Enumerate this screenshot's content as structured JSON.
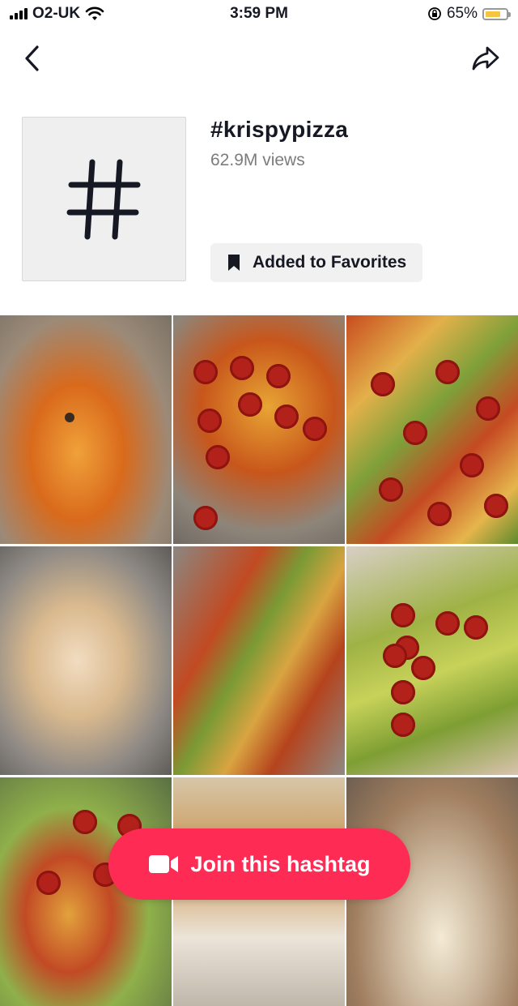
{
  "status_bar": {
    "carrier": "O2-UK",
    "time": "3:59 PM",
    "battery": "65%",
    "battery_level": 0.65
  },
  "hashtag": {
    "title": "#krispypizza",
    "views": "62.9M views",
    "favorite_label": "Added to Favorites"
  },
  "grid": {
    "thumbnails": [
      {
        "name": "video-thumb-1"
      },
      {
        "name": "video-thumb-2"
      },
      {
        "name": "video-thumb-3"
      },
      {
        "name": "video-thumb-4"
      },
      {
        "name": "video-thumb-5"
      },
      {
        "name": "video-thumb-6"
      },
      {
        "name": "video-thumb-7"
      },
      {
        "name": "video-thumb-8"
      },
      {
        "name": "video-thumb-9"
      }
    ]
  },
  "join_button": {
    "label": "Join this hashtag"
  },
  "icons": [
    "signal-icon",
    "wifi-icon",
    "rotation-lock-icon",
    "battery-icon",
    "back-icon",
    "share-icon",
    "hashtag-icon",
    "bookmark-icon",
    "video-camera-icon"
  ],
  "colors": {
    "accent": "#fe2c55",
    "battery": "#f5c542",
    "text": "#161823",
    "muted": "#7c7c7c"
  }
}
